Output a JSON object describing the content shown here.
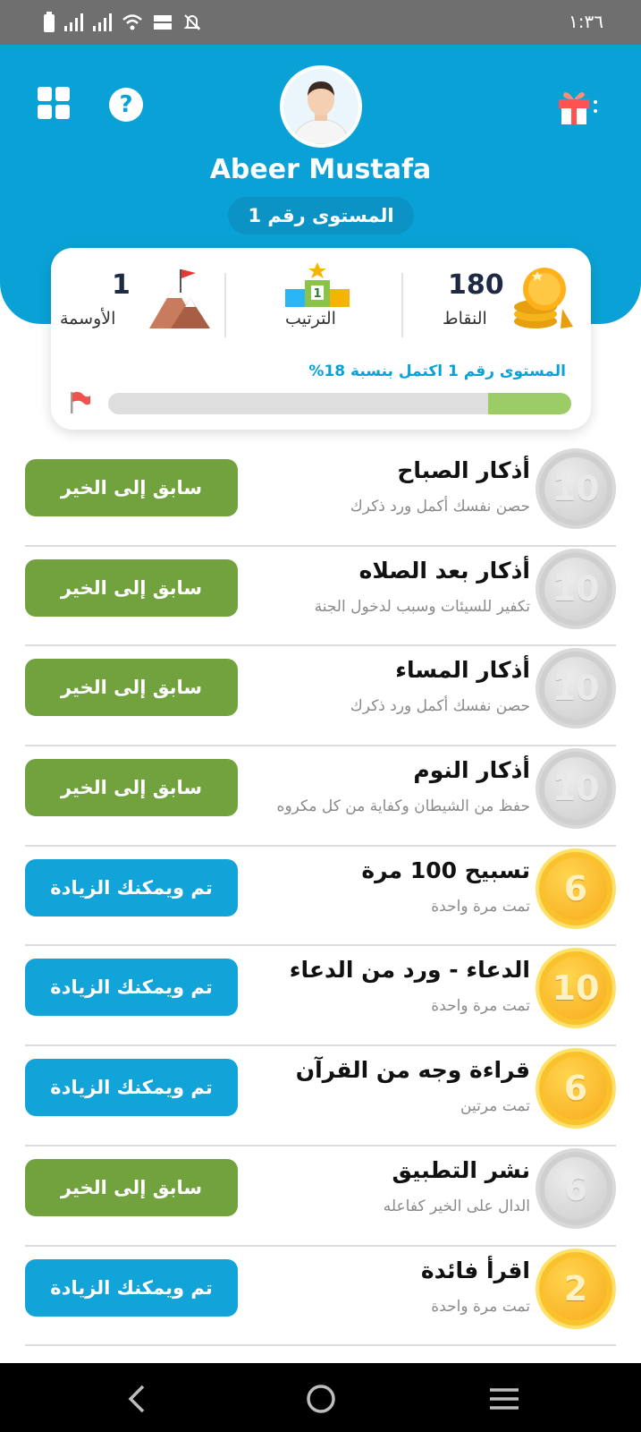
{
  "status_bar": {
    "time": "١:٣٦"
  },
  "profile": {
    "name": "Abeer Mustafa",
    "level_label": "المستوى رقم 1"
  },
  "stats": {
    "points_value": "180",
    "points_label": "النقاط",
    "rank_label": "الترتيب",
    "rank_badge": "1",
    "badges_value": "1",
    "badges_label": "الأوسمة",
    "progress_text": "المستوى رقم 1 اكتمل بنسبة 18%",
    "progress_percent": 18
  },
  "activities": [
    {
      "title": "أذكار الصباح",
      "subtitle": "حصن نفسك أكمل ورد ذكرك",
      "points": "10",
      "coin": "gray",
      "action": "سابق إلى الخير",
      "action_style": "green"
    },
    {
      "title": "أذكار بعد الصلاه",
      "subtitle": "تكفير للسيئات وسبب لدخول الجنة",
      "points": "10",
      "coin": "gray",
      "action": "سابق إلى الخير",
      "action_style": "green"
    },
    {
      "title": "أذكار المساء",
      "subtitle": "حصن نفسك أكمل ورد ذكرك",
      "points": "10",
      "coin": "gray",
      "action": "سابق إلى الخير",
      "action_style": "green"
    },
    {
      "title": "أذكار النوم",
      "subtitle": "حفظ من الشيطان وكفاية من كل مكروه",
      "points": "10",
      "coin": "gray",
      "action": "سابق إلى الخير",
      "action_style": "green"
    },
    {
      "title": "تسبيح 100 مرة",
      "subtitle": "تمت مرة واحدة",
      "points": "6",
      "coin": "gold",
      "action": "تم ويمكنك الزيادة",
      "action_style": "blue"
    },
    {
      "title": "الدعاء - ورد من الدعاء",
      "subtitle": "تمت مرة واحدة",
      "points": "10",
      "coin": "gold",
      "action": "تم ويمكنك الزيادة",
      "action_style": "blue"
    },
    {
      "title": "قراءة وجه من القرآن",
      "subtitle": "تمت مرتين",
      "points": "6",
      "coin": "gold",
      "action": "تم ويمكنك الزيادة",
      "action_style": "blue"
    },
    {
      "title": "نشر التطبيق",
      "subtitle": "الدال على الخير كفاعله",
      "points": "6",
      "coin": "gray",
      "action": "سابق إلى الخير",
      "action_style": "green"
    },
    {
      "title": "اقرأ فائدة",
      "subtitle": "تمت مرة واحدة",
      "points": "2",
      "coin": "gold",
      "action": "تم ويمكنك الزيادة",
      "action_style": "blue"
    }
  ],
  "icons": {
    "menu": "grid-icon",
    "help": "question-icon",
    "gift": "gift-icon",
    "points": "coins-icon",
    "rank": "podium-icon",
    "badges": "mountain-flag-icon",
    "progress_flag": "flag-icon",
    "help_glyph": "?"
  },
  "colors": {
    "header": "#0aa2d6",
    "progress_fill": "#9ccc65",
    "green_button": "#71a23d",
    "blue_button": "#12a3d8"
  }
}
